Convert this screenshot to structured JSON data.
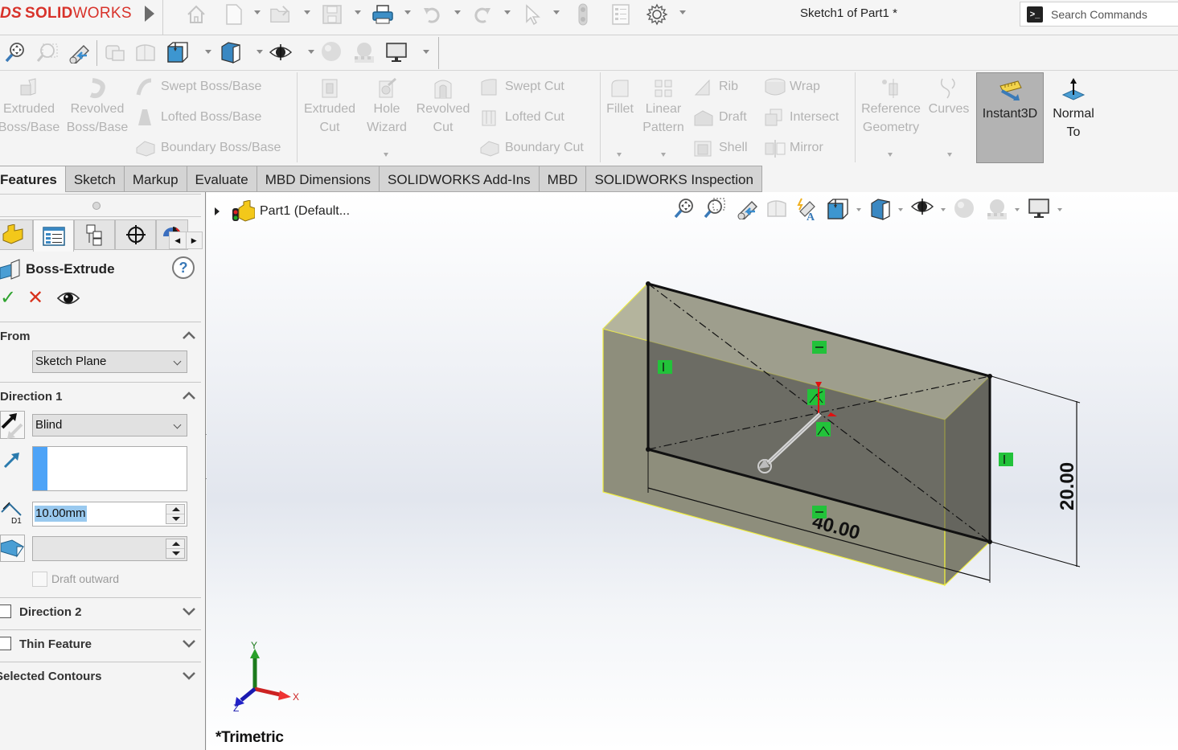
{
  "app": {
    "logo_prefix": "DS",
    "logo_bold": "SOLID",
    "logo_light": "WORKS",
    "document_title": "Sketch1 of Part1 *",
    "search_placeholder": "Search Commands"
  },
  "quick_access": [
    {
      "icon": "home-icon",
      "enabled": false
    },
    {
      "icon": "new-document-icon",
      "enabled": false,
      "dropdown": true
    },
    {
      "icon": "open-folder-icon",
      "enabled": false,
      "dropdown": true
    },
    {
      "icon": "save-icon",
      "enabled": false,
      "dropdown": true
    },
    {
      "icon": "print-icon",
      "enabled": true,
      "dropdown": true
    },
    {
      "icon": "undo-icon",
      "enabled": false,
      "dropdown": true
    },
    {
      "icon": "redo-icon",
      "enabled": false,
      "dropdown": true
    },
    {
      "icon": "select-pointer-icon",
      "enabled": false,
      "dropdown": true
    },
    {
      "icon": "rebuild-icon",
      "enabled": false
    },
    {
      "icon": "file-properties-icon",
      "enabled": false
    },
    {
      "icon": "options-gear-icon",
      "enabled": true,
      "dropdown": true
    }
  ],
  "view_toolbar": [
    "zoom-to-fit-icon",
    "zoom-to-area-icon",
    "previous-view-icon",
    "section-view-icon",
    "view-orientation-icon",
    "display-style-icon",
    "hide-show-items-icon",
    "edit-appearance-icon",
    "apply-scene-icon",
    "view-settings-icon"
  ],
  "command_manager": {
    "boss_group": {
      "large": [
        {
          "label_line1": "Extruded",
          "label_line2": "Boss/Base",
          "icon": "extruded-boss-icon"
        },
        {
          "label_line1": "Revolved",
          "label_line2": "Boss/Base",
          "icon": "revolved-boss-icon"
        }
      ],
      "small": [
        {
          "label": "Swept Boss/Base",
          "icon": "swept-boss-icon"
        },
        {
          "label": "Lofted Boss/Base",
          "icon": "lofted-boss-icon"
        },
        {
          "label": "Boundary Boss/Base",
          "icon": "boundary-boss-icon"
        }
      ]
    },
    "cut_group": {
      "large": [
        {
          "label_line1": "Extruded",
          "label_line2": "Cut",
          "icon": "extruded-cut-icon"
        },
        {
          "label_line1": "Hole",
          "label_line2": "Wizard",
          "icon": "hole-wizard-icon"
        },
        {
          "label_line1": "Revolved",
          "label_line2": "Cut",
          "icon": "revolved-cut-icon"
        }
      ],
      "small": [
        {
          "label": "Swept Cut",
          "icon": "swept-cut-icon"
        },
        {
          "label": "Lofted Cut",
          "icon": "lofted-cut-icon"
        },
        {
          "label": "Boundary Cut",
          "icon": "boundary-cut-icon"
        }
      ]
    },
    "feature_group": {
      "large": [
        {
          "label_line1": "Fillet",
          "label_line2": "",
          "icon": "fillet-icon"
        },
        {
          "label_line1": "Linear",
          "label_line2": "Pattern",
          "icon": "linear-pattern-icon"
        }
      ],
      "small_col1": [
        {
          "label": "Rib",
          "icon": "rib-icon"
        },
        {
          "label": "Draft",
          "icon": "draft-icon"
        },
        {
          "label": "Shell",
          "icon": "shell-icon"
        }
      ],
      "small_col2": [
        {
          "label": "Wrap",
          "icon": "wrap-icon"
        },
        {
          "label": "Intersect",
          "icon": "intersect-icon"
        },
        {
          "label": "Mirror",
          "icon": "mirror-icon"
        }
      ]
    },
    "ref_group": [
      {
        "label_line1": "Reference",
        "label_line2": "Geometry",
        "icon": "reference-geometry-icon"
      },
      {
        "label_line1": "Curves",
        "label_line2": "",
        "icon": "curves-icon"
      }
    ],
    "instant3d": {
      "label": "Instant3D",
      "active": true
    },
    "normal_to": {
      "label_line1": "Normal",
      "label_line2": "To"
    }
  },
  "tabs": [
    {
      "label": "Features",
      "active": true
    },
    {
      "label": "Sketch",
      "active": false
    },
    {
      "label": "Markup",
      "active": false
    },
    {
      "label": "Evaluate",
      "active": false
    },
    {
      "label": "MBD Dimensions",
      "active": false
    },
    {
      "label": "SOLIDWORKS Add-Ins",
      "active": false
    },
    {
      "label": "MBD",
      "active": false
    },
    {
      "label": "SOLIDWORKS Inspection",
      "active": false
    }
  ],
  "property_manager": {
    "title": "Boss-Extrude",
    "help": "?",
    "ok_glyph": "✓",
    "cancel_glyph": "✕",
    "from": {
      "title": "From",
      "value": "Sketch Plane"
    },
    "direction1": {
      "title": "Direction 1",
      "end_condition": "Blind",
      "direction_selection": "",
      "depth": "10.00mm",
      "draft_angle": "",
      "draft_outward_label": "Draft outward",
      "draft_outward_checked": false
    },
    "direction2": {
      "title": "Direction 2",
      "checked": false
    },
    "thin_feature": {
      "title": "Thin Feature",
      "checked": false
    },
    "selected_contours": {
      "title": "Selected Contours"
    }
  },
  "graphics": {
    "tree_root": "Part1  (Default...",
    "view_orientation": "*Trimetric",
    "dimensions": {
      "width": "40.00",
      "height": "20.00"
    },
    "triad": {
      "x": "X",
      "y": "Y",
      "z": "Z"
    }
  },
  "colors": {
    "brand_red": "#d8322a",
    "preview_yellow": "#f0ee3c",
    "relation_green": "#22c23a",
    "highlight_blue": "#4da3f7"
  }
}
